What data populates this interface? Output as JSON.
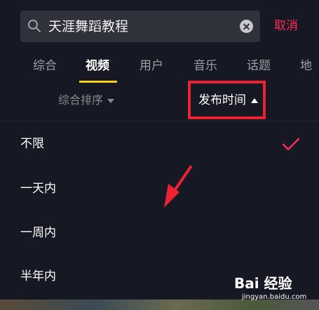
{
  "search": {
    "query": "天涯舞蹈教程",
    "cancel_label": "取消"
  },
  "tabs": [
    {
      "label": "综合",
      "active": false
    },
    {
      "label": "视频",
      "active": true
    },
    {
      "label": "用户",
      "active": false
    },
    {
      "label": "音乐",
      "active": false
    },
    {
      "label": "话题",
      "active": false
    },
    {
      "label": "地",
      "active": false
    }
  ],
  "filters": {
    "sort_label": "综合排序",
    "time_label": "发布时间"
  },
  "time_options": [
    {
      "label": "不限",
      "selected": true
    },
    {
      "label": "一天内",
      "selected": false
    },
    {
      "label": "一周内",
      "selected": false
    },
    {
      "label": "半年内",
      "selected": false
    }
  ],
  "watermark": {
    "brand": "Bai 经验",
    "url": "jingyan.baidu.com"
  },
  "colors": {
    "background": "#161823",
    "accent_red": "#fe2c55",
    "tab_underline": "#face15",
    "highlight_box": "#ea2232"
  }
}
